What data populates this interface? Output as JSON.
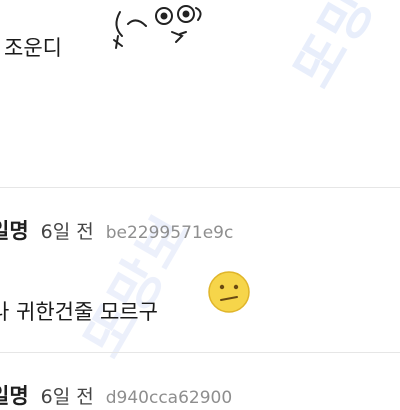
{
  "top_comment": {
    "text": "조운디"
  },
  "comments": [
    {
      "author": "일명",
      "time": "6일 전",
      "hash": "be2299571e9c",
      "text": "나 귀한건줄 모르구"
    },
    {
      "author": "일명",
      "time": "6일 전",
      "hash": "d940cca62900"
    }
  ],
  "watermark": "또망보",
  "colors": {
    "divider": "#e6e6e6",
    "hash": "#8e8e8e",
    "emoji": "#f6d54a"
  }
}
